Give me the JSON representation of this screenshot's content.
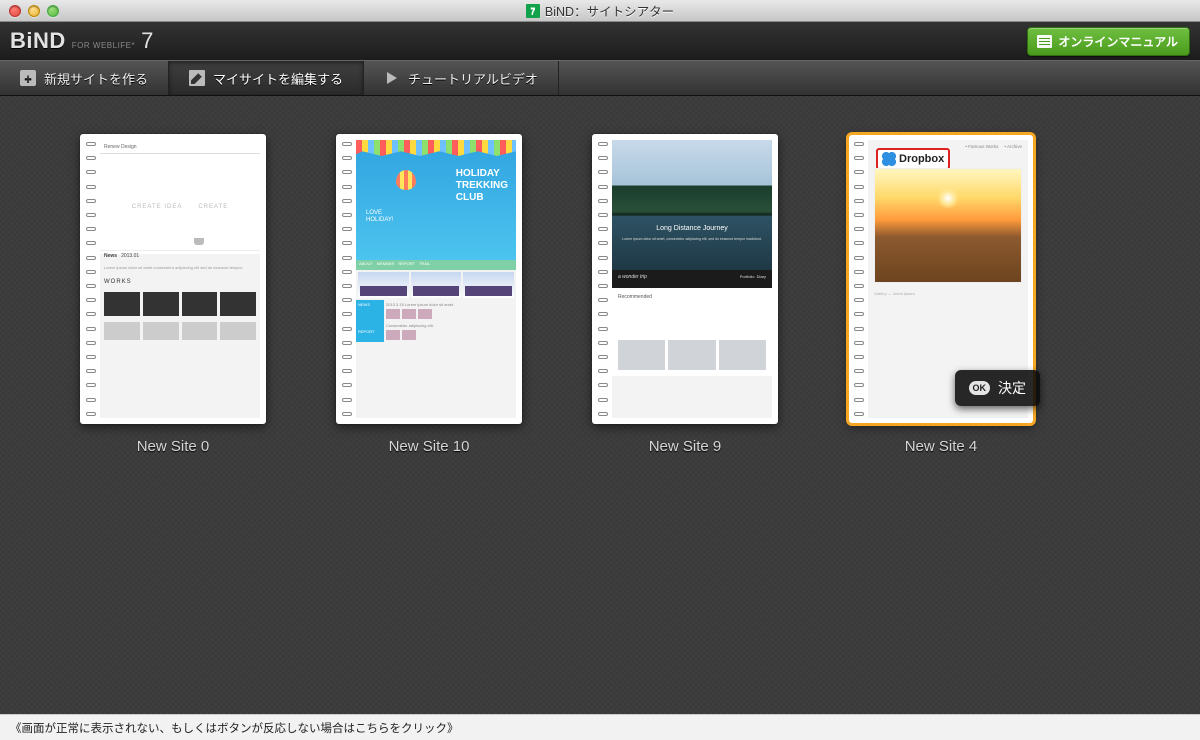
{
  "window": {
    "title": "BiND：サイトシアター",
    "app_icon_text": "7"
  },
  "brand": {
    "main": "BiND",
    "sub": "FOR WEBLIFE*",
    "version": "7"
  },
  "header": {
    "manual_button": "オンラインマニュアル"
  },
  "tabs": {
    "new_site": "新規サイトを作る",
    "edit_site": "マイサイトを編集する",
    "tutorial": "チュートリアルビデオ"
  },
  "sites": [
    {
      "name": "New Site 0",
      "selected": false
    },
    {
      "name": "New Site 10",
      "selected": false
    },
    {
      "name": "New Site 9",
      "selected": false
    },
    {
      "name": "New Site 4",
      "selected": true
    }
  ],
  "dropbox_badge": "Dropbox",
  "decide_button": {
    "ok": "OK",
    "label": "決定"
  },
  "footer": {
    "hint": "《画面が正常に表示されない、もしくはボタンが反応しない場合はこちらをクリック》"
  },
  "preview_text": {
    "pv0_create": "CREATE IDEA      CREATE",
    "pv0_works": "WORKS",
    "pv1_title": "HOLIDAY\nTREKKING\nCLUB",
    "pv1_love": "LOVE\nHOLIDAY!",
    "pv1_news": "NEWS",
    "pv1_report": "REPORT",
    "pv2_title": "Long Distance Journey",
    "pv2_nav": "a wonder trip",
    "pv2_recom": "Recommended"
  }
}
